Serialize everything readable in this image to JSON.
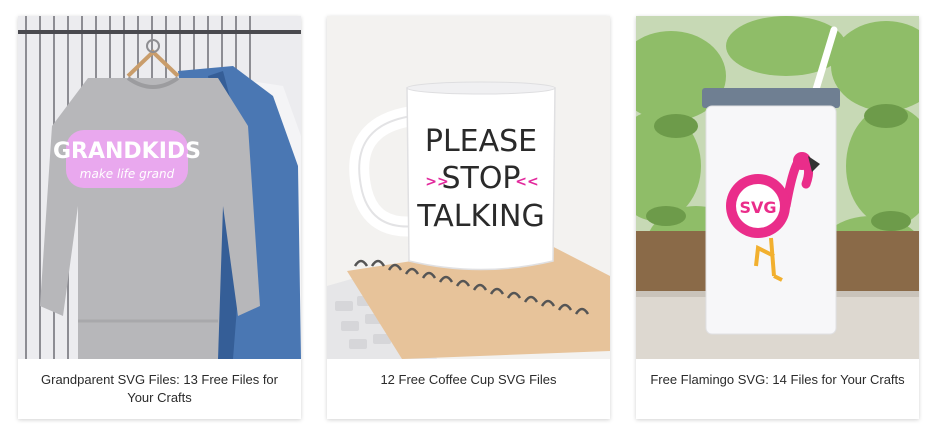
{
  "cards": [
    {
      "title": "Grandparent SVG Files: 13 Free Files for Your Crafts",
      "image": {
        "design_line1": "GRANDKIDS",
        "design_line2": "make life grand",
        "colors": {
          "sweatshirt": "#b9b9bb",
          "design": "#d35fd8",
          "background": "#e9e9ec"
        }
      }
    },
    {
      "title": "12 Free Coffee Cup SVG Files",
      "image": {
        "design_line1": "PLEASE",
        "design_line2": "STOP",
        "design_line3": "TALKING",
        "arrows_left": ">>",
        "arrows_right": "<<",
        "colors": {
          "mug": "#ffffff",
          "text": "#2a2a2a",
          "accent": "#e2289c",
          "notebook": "#e8c39a"
        }
      }
    },
    {
      "title": "Free Flamingo SVG: 14 Files for Your Crafts",
      "image": {
        "monogram": "SVG",
        "colors": {
          "tumbler": "#f5f5f7",
          "flamingo": "#ea2d8a",
          "foliage": "#8db86a",
          "legs": "#f2b02f"
        }
      }
    }
  ]
}
